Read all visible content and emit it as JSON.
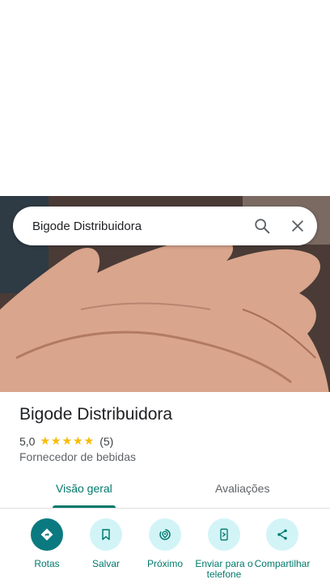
{
  "search": {
    "query": "Bigode Distribuidora"
  },
  "place": {
    "name": "Bigode Distribuidora",
    "rating": "5,0",
    "stars": "★★★★★",
    "star_fraction": 1.0,
    "review_count": "(5)",
    "category": "Fornecedor de bebidas"
  },
  "tabs": [
    {
      "label": "Visão geral",
      "active": true
    },
    {
      "label": "Avaliações",
      "active": false
    }
  ],
  "actions": [
    {
      "label": "Rotas",
      "icon": "directions-icon"
    },
    {
      "label": "Salvar",
      "icon": "bookmark-icon"
    },
    {
      "label": "Próximo",
      "icon": "nearby-icon"
    },
    {
      "label": "Enviar para o telefone",
      "icon": "send-to-phone-icon"
    },
    {
      "label": "Compartilhar",
      "icon": "share-icon"
    }
  ],
  "colors": {
    "accent": "#00796b",
    "primary_button": "#0b7a80",
    "secondary_button": "#d2f4f7",
    "star": "#fbbc04"
  }
}
